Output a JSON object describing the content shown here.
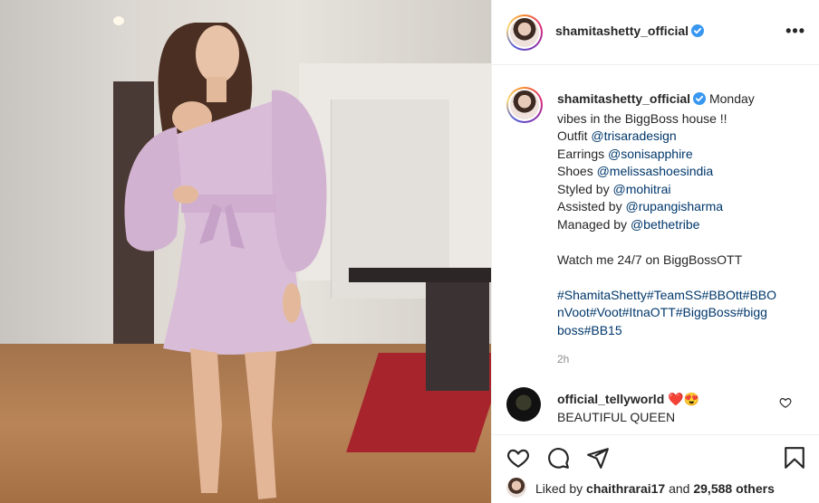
{
  "post": {
    "username": "shamitashetty_official",
    "more_icon": "more-options-icon",
    "caption": {
      "author": "shamitashetty_official",
      "lines": [
        {
          "prefix": "",
          "text": "Monday"
        },
        {
          "prefix": "vibes in the BiggBoss house !!",
          "link": ""
        },
        {
          "prefix": "Outfit ",
          "link": "@trisaradesign"
        },
        {
          "prefix": "Earrings ",
          "link": "@sonisapphire"
        },
        {
          "prefix": "Shoes ",
          "link": "@melissashoesindia"
        },
        {
          "prefix": "Styled by ",
          "link": "@mohitrai"
        },
        {
          "prefix": "Assisted by ",
          "link": "@rupangisharma"
        },
        {
          "prefix": "Managed by ",
          "link": "@bethetribe"
        },
        {
          "prefix": "",
          "link": ""
        },
        {
          "prefix": "Watch me 24/7 on BiggBossOTT",
          "link": ""
        },
        {
          "prefix": "",
          "link": ""
        },
        {
          "prefix": "",
          "link": "#ShamitaShetty#TeamSS#BBOtt#BBO"
        },
        {
          "prefix": "",
          "link": "nVoot#Voot#ItnaOTT#BiggBoss#bigg"
        },
        {
          "prefix": "",
          "link": "boss#BB15"
        }
      ]
    },
    "time_ago": "2h",
    "comment": {
      "username": "official_tellyworld",
      "emojis": "❤️😍",
      "text": "BEAUTIFUL QUEEN"
    },
    "likes": {
      "prefix": "Liked by ",
      "user": "chaithrarai17",
      "middle": " and ",
      "count": "29,588 others"
    }
  },
  "colors": {
    "verified": "#3897f0",
    "link": "#00376b",
    "muted": "#8e8e8e",
    "heart_red": "#ed4956"
  }
}
